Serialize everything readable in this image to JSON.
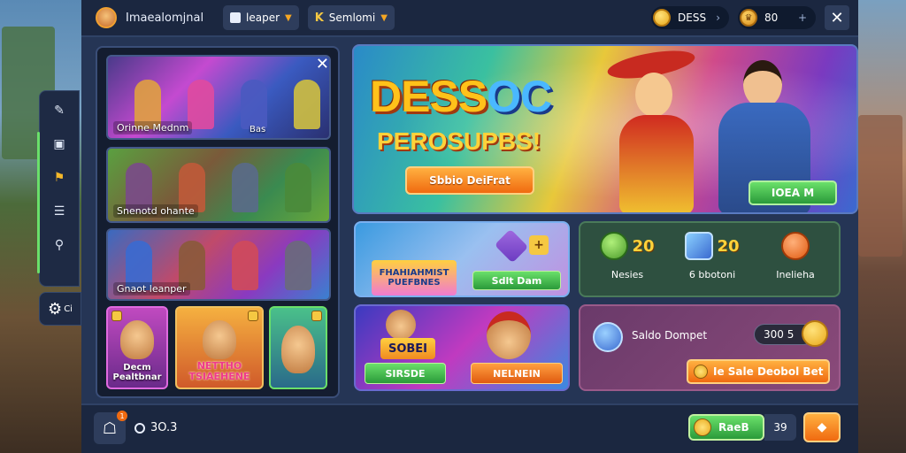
{
  "topbar": {
    "title": "Imaealomjnal",
    "tab1": "leaper",
    "tab2": "Semlomi",
    "currency1": "DESS",
    "currency2": "80",
    "close_symbol": "✕"
  },
  "sidenav": {
    "settings_label": "Ci"
  },
  "left_panel": {
    "close_symbol": "✕",
    "cards": [
      {
        "label": "Orinne Mednm",
        "sublabel": "Bas"
      },
      {
        "label": "Snenotd ohante",
        "sublabel": ""
      },
      {
        "label": "Gnaot leanper",
        "sublabel": ""
      }
    ],
    "tiles": [
      {
        "label": "Decm\nPealtbnar"
      },
      {
        "label": "NETTHO\nTSIAEHENE"
      },
      {
        "label": ""
      }
    ]
  },
  "banner": {
    "title_part1": "DESS",
    "title_part2": "OC",
    "subtitle": "PEROSUPBS!",
    "cta": "Sbbio DeiFrat",
    "cta2": "IOEA M"
  },
  "card_mission": {
    "logo_text": "FHAHIAHMIST\nPUEFBNES",
    "button": "Sdlt Dam",
    "plus": "+"
  },
  "stats": [
    {
      "value": "20",
      "label": "Nesies",
      "color": "#7ad040"
    },
    {
      "value": "20",
      "label": "6 bbotoni",
      "color": "#3a9ae0"
    },
    {
      "value": "",
      "label": "Inelieha",
      "color": "#f08a20"
    }
  ],
  "card_event": {
    "title": "SOBEI",
    "button1": "SIRSDE",
    "button2": "NELNEIN"
  },
  "card_wallet": {
    "label": "Saldo Dompet",
    "amount": "300 5",
    "button": "Ie Sale Deobol Bet"
  },
  "bottombar": {
    "value": "3O.3",
    "cta": "RaeB",
    "count": "39",
    "go_symbol": "◆",
    "badge": "1"
  },
  "colors": {
    "accent_orange": "#f06a10",
    "accent_green": "#2a9a3a",
    "gold": "#ffc21a",
    "panel": "#253555"
  }
}
